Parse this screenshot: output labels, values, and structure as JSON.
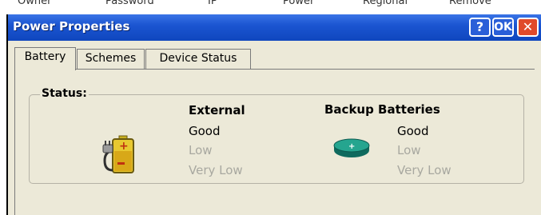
{
  "background_window": {
    "tabs": [
      "Owner",
      "Password",
      "IP",
      "Power",
      "Regional",
      "Remove"
    ]
  },
  "dialog": {
    "title": "Power Properties",
    "buttons": {
      "help": "?",
      "ok": "OK",
      "close": "✕"
    }
  },
  "tabs": [
    {
      "label": "Battery",
      "active": true
    },
    {
      "label": "Schemes",
      "active": false
    },
    {
      "label": "Device Status",
      "active": false
    }
  ],
  "status": {
    "label": "Status:",
    "external": {
      "header": "External",
      "icon": "battery-plug-icon",
      "levels": [
        "Good",
        "Low",
        "Very Low"
      ],
      "current": "Good"
    },
    "backup": {
      "header": "Backup Batteries",
      "icon": "coin-battery-icon",
      "levels": [
        "Good",
        "Low",
        "Very Low"
      ],
      "current": "Good"
    }
  },
  "colors": {
    "titlebar": "#1b55d1",
    "dialog_bg": "#ece9d8",
    "dim_text": "#a8a8a0",
    "close_button": "#e04a2a",
    "coin_battery": "#1a8a7a"
  }
}
